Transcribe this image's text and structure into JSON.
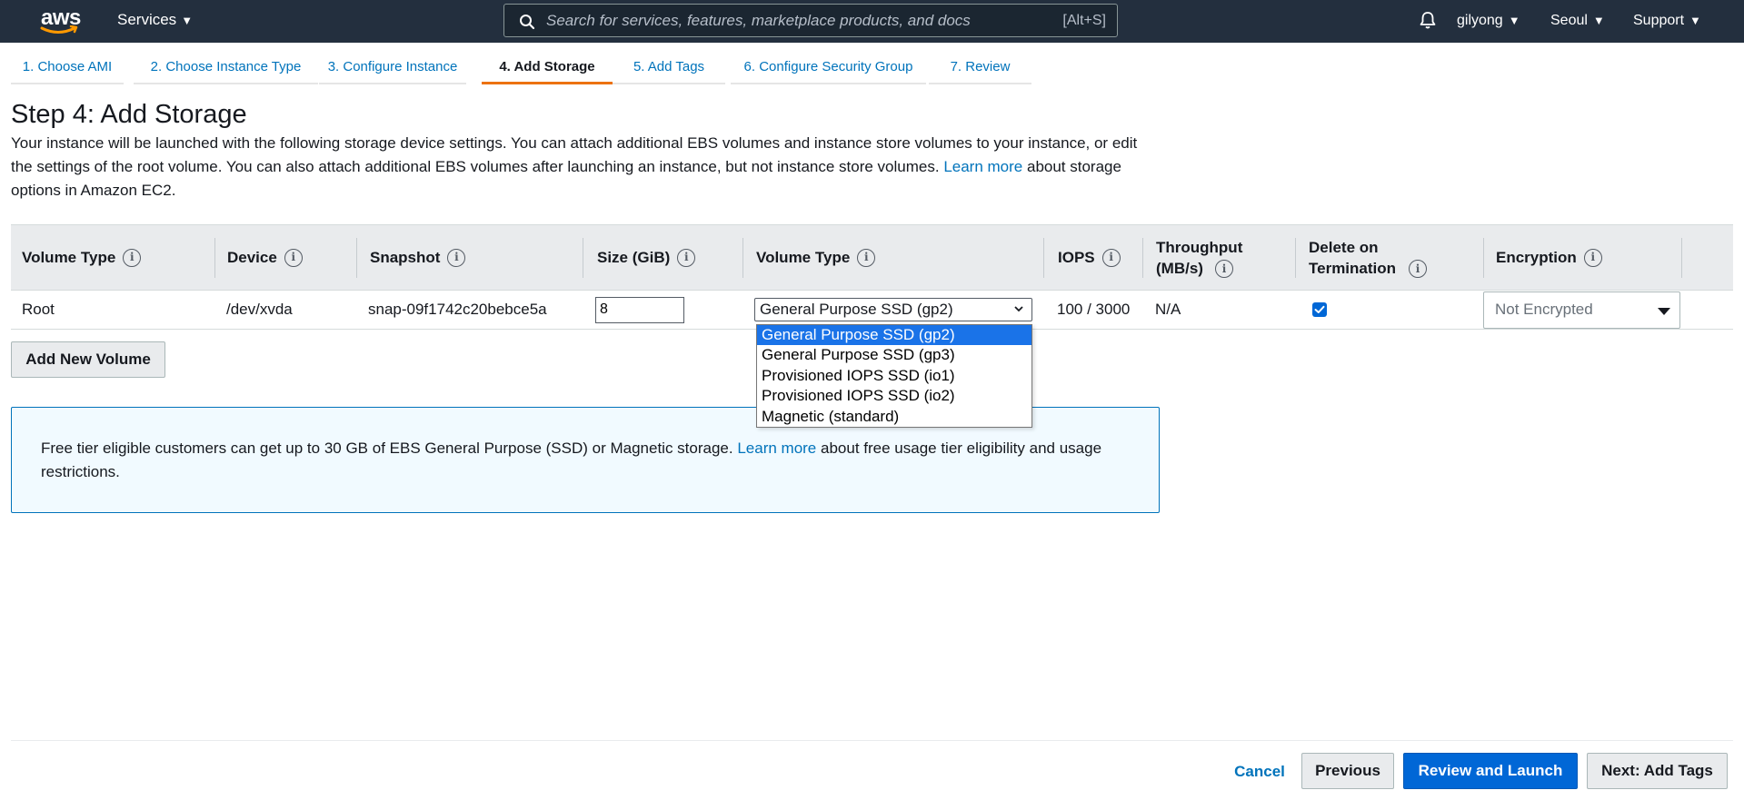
{
  "topnav": {
    "logo_text": "aws",
    "services_label": "Services",
    "search_placeholder": "Search for services, features, marketplace products, and docs",
    "search_shortcut": "[Alt+S]",
    "user_label": "gilyong",
    "region_label": "Seoul",
    "support_label": "Support"
  },
  "wizard_tabs": [
    {
      "label": "1. Choose AMI"
    },
    {
      "label": "2. Choose Instance Type"
    },
    {
      "label": "3. Configure Instance"
    },
    {
      "label": "4. Add Storage",
      "active": true
    },
    {
      "label": "5. Add Tags"
    },
    {
      "label": "6. Configure Security Group"
    },
    {
      "label": "7. Review"
    }
  ],
  "page": {
    "title": "Step 4: Add Storage",
    "description_part1": "Your instance will be launched with the following storage device settings. You can attach additional EBS volumes and instance store volumes to your instance, or edit the settings of the root volume. You can also attach additional EBS volumes after launching an instance, but not instance store volumes.",
    "learn_more": "Learn more",
    "description_part2": "about storage options in Amazon EC2."
  },
  "table": {
    "headers": {
      "volume_type": "Volume Type",
      "device": "Device",
      "snapshot": "Snapshot",
      "size": "Size (GiB)",
      "volume_type2": "Volume Type",
      "iops": "IOPS",
      "throughput": "Throughput (MB/s)",
      "delete_on_termination": "Delete on Termination",
      "encryption": "Encryption"
    },
    "rows": [
      {
        "volume_type": "Root",
        "device": "/dev/xvda",
        "snapshot": "snap-09f1742c20bebce5a",
        "size": "8",
        "volume_type_selected": "General Purpose SSD (gp2)",
        "iops": "100 / 3000",
        "throughput": "N/A",
        "delete_on_termination": true,
        "encryption": "Not Encrypted"
      }
    ]
  },
  "volume_type_options": [
    "General Purpose SSD (gp2)",
    "General Purpose SSD (gp3)",
    "Provisioned IOPS SSD (io1)",
    "Provisioned IOPS SSD (io2)",
    "Magnetic (standard)"
  ],
  "buttons": {
    "add_new_volume": "Add New Volume",
    "cancel": "Cancel",
    "previous": "Previous",
    "review_and_launch": "Review and Launch",
    "next": "Next: Add Tags"
  },
  "info_box": {
    "text_part1": "Free tier eligible customers can get up to 30 GB of EBS General Purpose (SSD) or Magnetic storage.",
    "learn_more": "Learn more",
    "text_part2": "about free usage tier eligibility and usage restrictions."
  },
  "colors": {
    "nav_bg": "#232f3e",
    "link": "#0073bb",
    "primary": "#0067d6",
    "active_tab": "#ec7211",
    "info_bg": "#f1faff"
  }
}
